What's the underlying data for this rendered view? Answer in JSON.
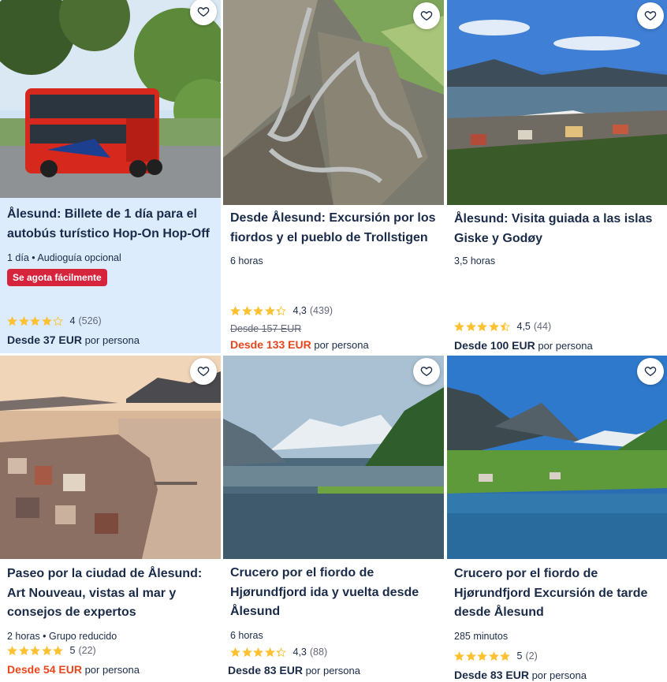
{
  "cards": [
    {
      "title": "Ålesund: Billete de 1 día para el autobús turístico Hop-On Hop-Off",
      "meta": "1 día • Audioguía opcional",
      "badge": "Se agota fácilmente",
      "rating": {
        "stars": 4,
        "value": "4",
        "count": "(526)"
      },
      "price_prefix": "Desde 37 EUR",
      "price_suffix": "por persona",
      "image": "bus-photo",
      "highlighted": true
    },
    {
      "title": "Desde Ålesund: Excursión por los fiordos y el pueblo de Trollstigen",
      "meta": "6 horas",
      "rating": {
        "stars": 4.3,
        "value": "4,3",
        "count": "(439)"
      },
      "old_price": "Desde 157 EUR",
      "price_prefix": "Desde 133 EUR",
      "price_suffix": "por persona",
      "image": "mountain-road-photo",
      "sale": true
    },
    {
      "title": "Ålesund: Visita guiada a las islas Giske y Godøy",
      "meta": "3,5 horas",
      "rating": {
        "stars": 4.5,
        "value": "4,5",
        "count": "(44)"
      },
      "price_prefix": "Desde 100 EUR",
      "price_suffix": "por persona",
      "image": "harbor-town-photo"
    },
    {
      "title": "Paseo por la ciudad de Ålesund: Art Nouveau, vistas al mar y consejos de expertos",
      "meta": "2 horas • Grupo reducido",
      "rating": {
        "stars": 5,
        "value": "5",
        "count": "(22)"
      },
      "price_prefix": "Desde 54 EUR",
      "price_suffix": "por persona",
      "image": "city-sunset-photo",
      "sale": true
    },
    {
      "title": "Crucero por el fiordo de Hjørundfjord ida y vuelta desde Ålesund",
      "meta": "6 horas",
      "rating": {
        "stars": 4.3,
        "value": "4,3",
        "count": "(88)"
      },
      "price_prefix": "Desde 83 EUR",
      "price_suffix": "por persona",
      "image": "fjord-photo"
    },
    {
      "title": "Crucero por el fiordo de Hjørundfjord Excursión de tarde desde Ålesund",
      "meta": "285 minutos",
      "rating": {
        "stars": 5,
        "value": "5",
        "count": "(2)"
      },
      "price_prefix": "Desde 83 EUR",
      "price_suffix": "por persona",
      "image": "green-fjord-photo"
    }
  ],
  "colors": {
    "title": "#1a2b49",
    "sale_price": "#e8461d",
    "badge": "#d7243d",
    "star": "#fdc132",
    "highlight_bg": "#dcecfc"
  },
  "icons": {
    "wishlist": "heart-outline-icon",
    "rating": "star-icon"
  }
}
